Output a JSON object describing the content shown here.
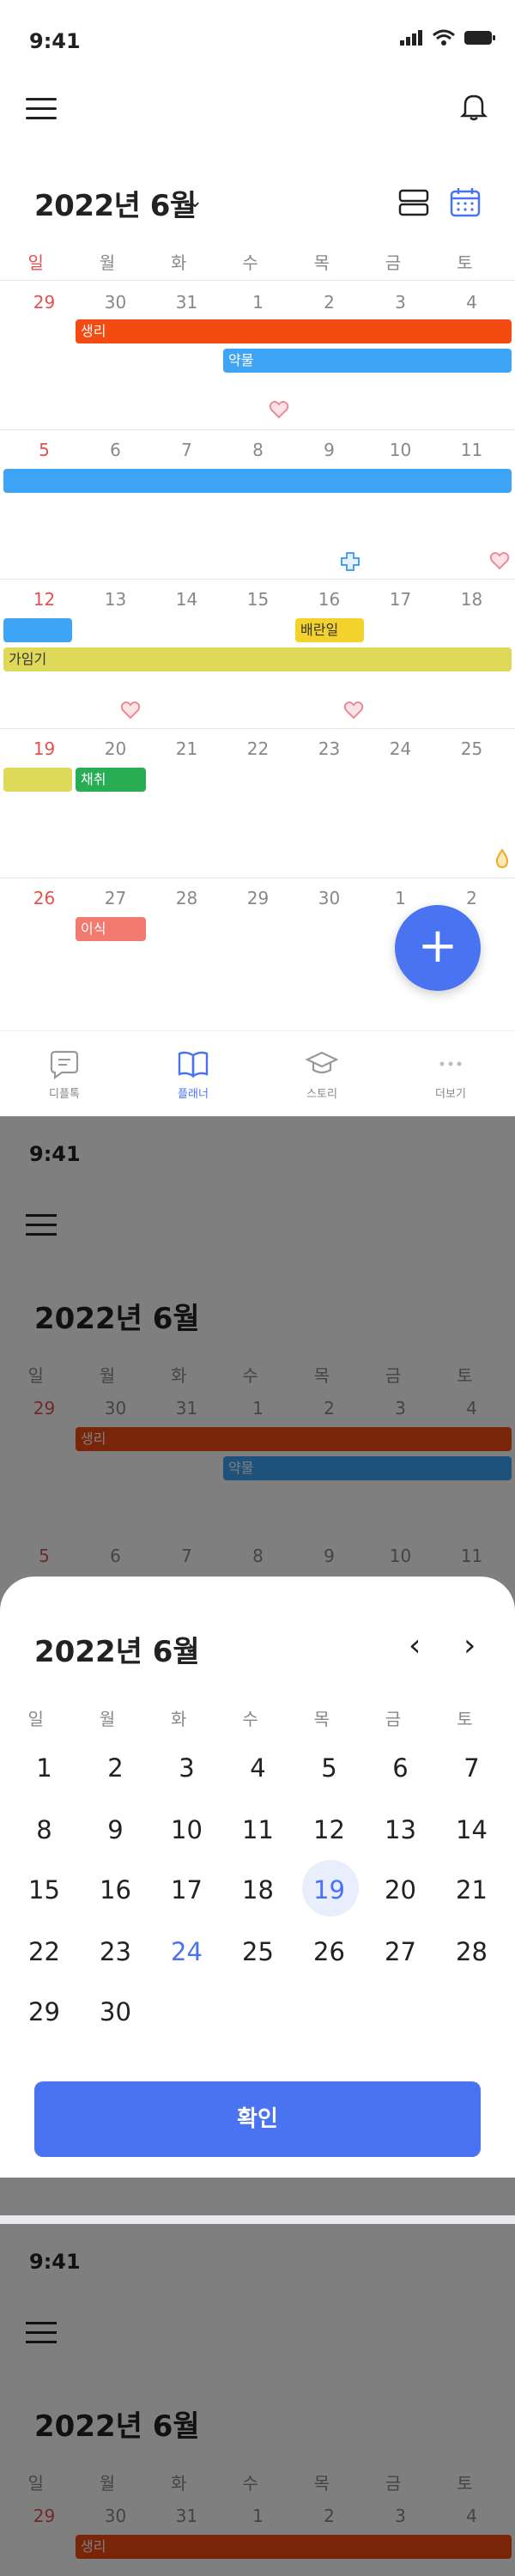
{
  "status": {
    "time": "9:41"
  },
  "header": {
    "month_title": "2022년 6월",
    "chevron": "⌄"
  },
  "weekdays": [
    "일",
    "월",
    "화",
    "수",
    "목",
    "금",
    "토"
  ],
  "weeks": [
    [
      "29",
      "30",
      "31",
      "1",
      "2",
      "3",
      "4"
    ],
    [
      "5",
      "6",
      "7",
      "8",
      "9",
      "10",
      "11"
    ],
    [
      "12",
      "13",
      "14",
      "15",
      "16",
      "17",
      "18"
    ],
    [
      "19",
      "20",
      "21",
      "22",
      "23",
      "24",
      "25"
    ],
    [
      "26",
      "27",
      "28",
      "29",
      "30",
      "1",
      "2"
    ]
  ],
  "events": {
    "period": "생리",
    "medicine": "약물",
    "ovulation": "배란일",
    "fertile": "가임기",
    "blood_draw": "채취",
    "transfer": "이식"
  },
  "colors": {
    "accent": "#4a73f2",
    "period": "#f34b12",
    "medicine": "#3ea4f5",
    "ovulation": "#f3d22b",
    "fertile": "#dfd95a",
    "blood_draw": "#27ae55",
    "transfer": "#f27a6e",
    "heart": "#f3a0a8"
  },
  "tabs": [
    {
      "label": "디플톡",
      "icon": "chat-icon"
    },
    {
      "label": "플래너",
      "icon": "book-icon"
    },
    {
      "label": "스토리",
      "icon": "graduation-cap-icon"
    },
    {
      "label": "더보기",
      "icon": "more-icon"
    }
  ],
  "sheet": {
    "title": "2022년 6월",
    "arrow": "›",
    "prev": "‹",
    "next": "›",
    "weekdays": [
      "일",
      "월",
      "화",
      "수",
      "목",
      "금",
      "토"
    ],
    "days": [
      [
        "1",
        "2",
        "3",
        "4",
        "5",
        "6",
        "7"
      ],
      [
        "8",
        "9",
        "10",
        "11",
        "12",
        "13",
        "14"
      ],
      [
        "15",
        "16",
        "17",
        "18",
        "19",
        "20",
        "21"
      ],
      [
        "22",
        "23",
        "24",
        "25",
        "26",
        "27",
        "28"
      ],
      [
        "29",
        "30"
      ]
    ],
    "selected": "19",
    "today": "24",
    "confirm_label": "확인"
  }
}
